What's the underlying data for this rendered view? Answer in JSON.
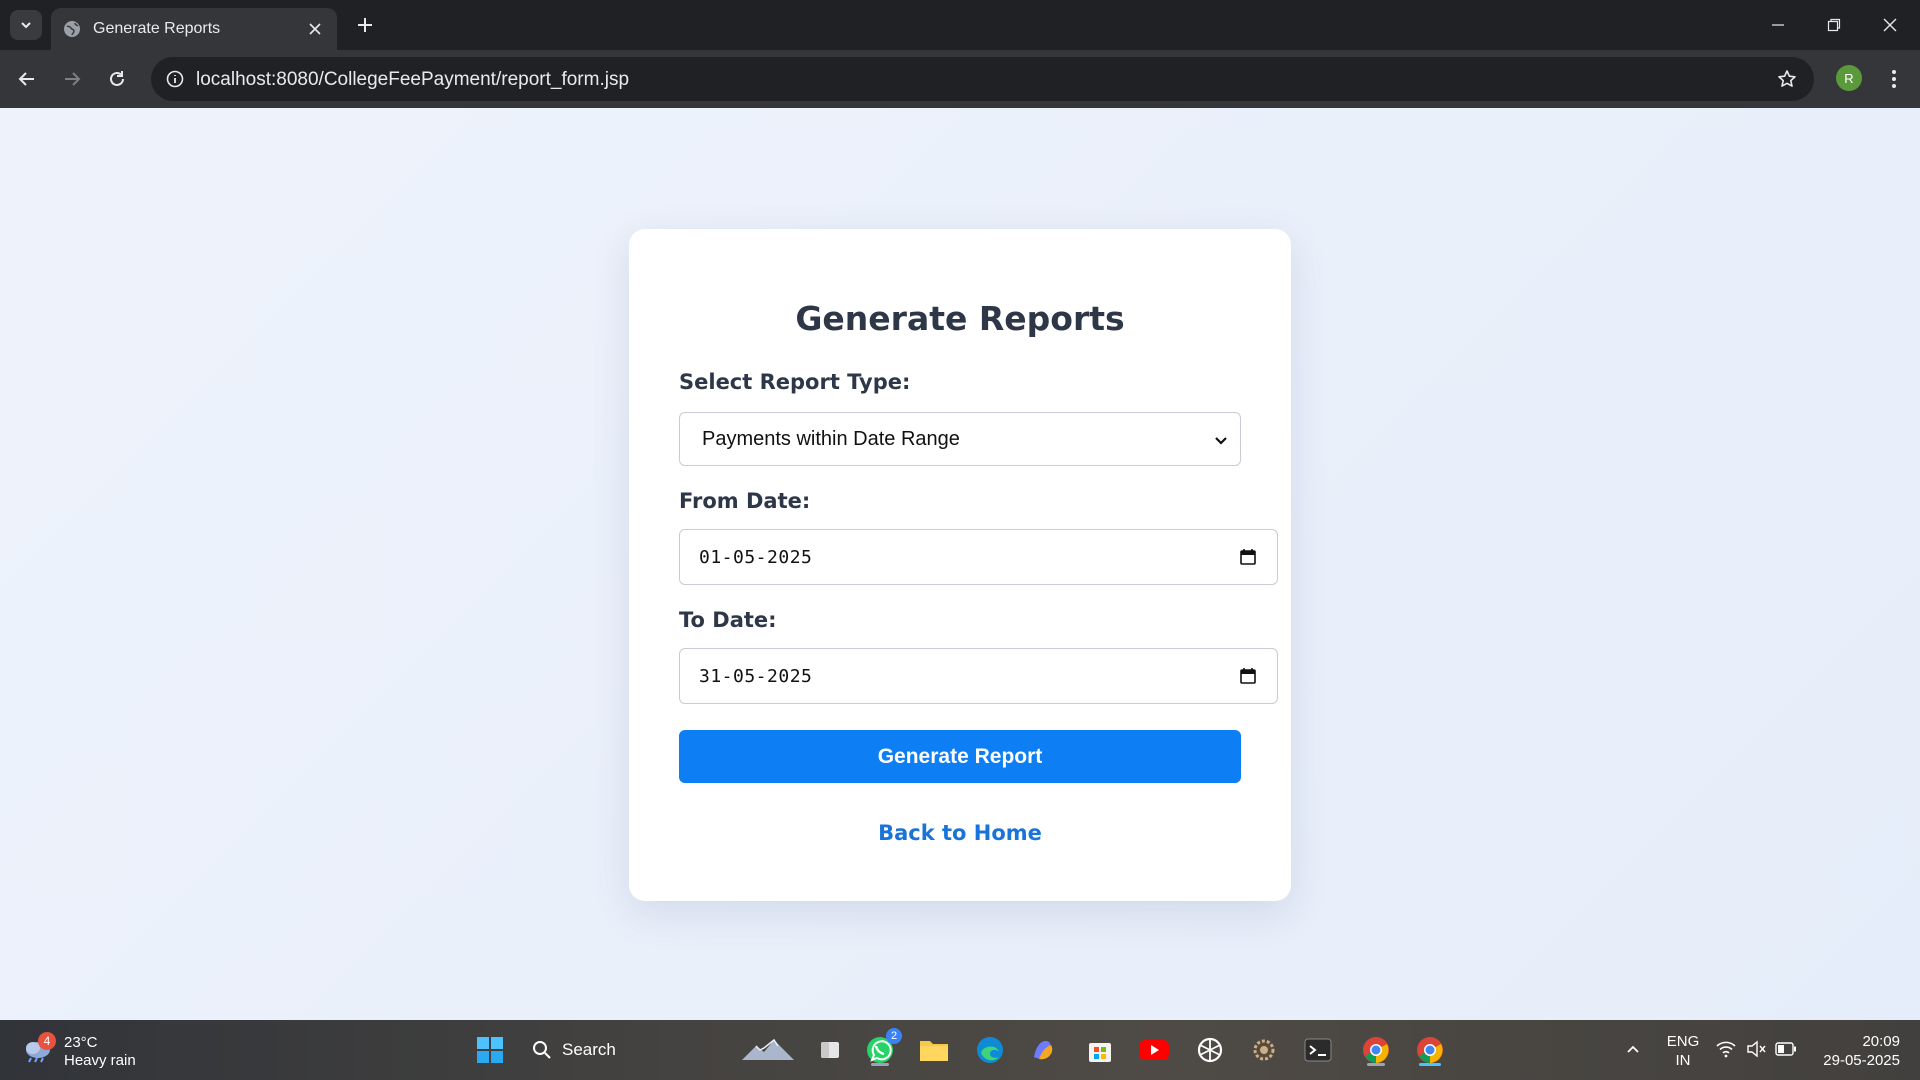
{
  "browser": {
    "tab_title": "Generate Reports",
    "url": "localhost:8080/CollegeFeePayment/report_form.jsp",
    "profile_initial": "R"
  },
  "page": {
    "title": "Generate Reports",
    "report_type_label": "Select Report Type:",
    "report_type_value": "Payments within Date Range",
    "from_label": "From Date:",
    "from_value": "01-05-2025",
    "to_label": "To Date:",
    "to_value": "31-05-2025",
    "submit_label": "Generate Report",
    "back_label": "Back to Home"
  },
  "colors": {
    "accent": "#0d7ef4",
    "link": "#1a73d9",
    "heading": "#2d3748"
  },
  "taskbar": {
    "weather_temp": "23°C",
    "weather_desc": "Heavy rain",
    "weather_badge": "4",
    "search_label": "Search",
    "whatsapp_badge": "2",
    "lang_line1": "ENG",
    "lang_line2": "IN",
    "time": "20:09",
    "date": "29-05-2025"
  }
}
